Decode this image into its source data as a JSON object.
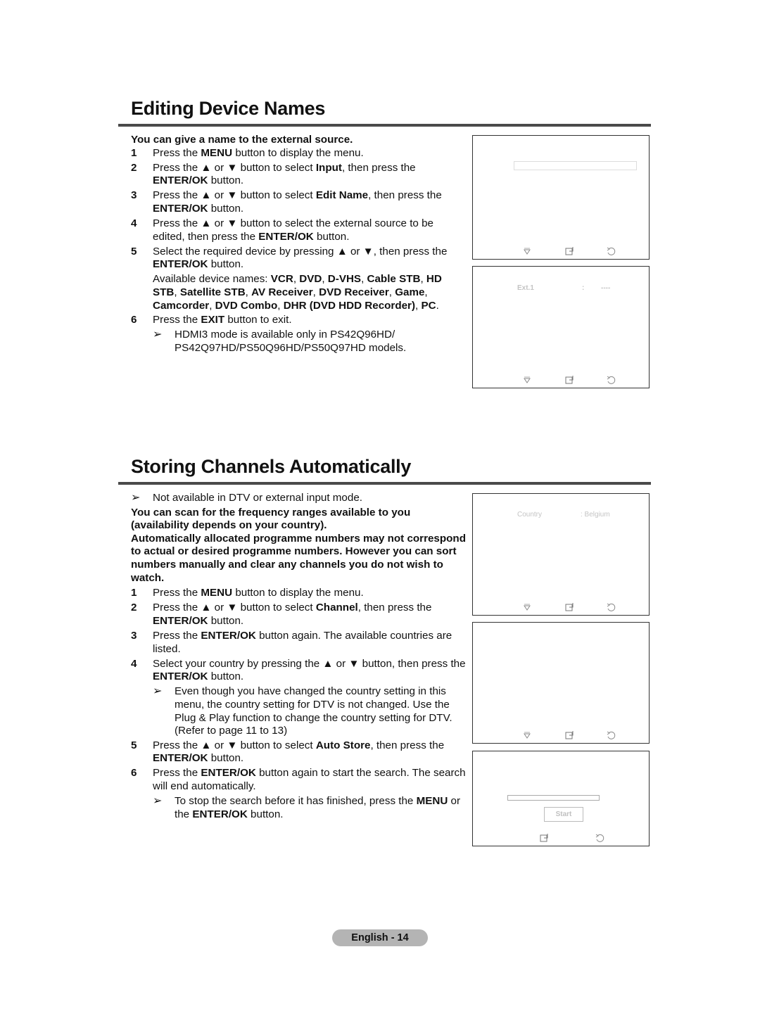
{
  "section1": {
    "title": "Editing Device Names",
    "lead": "You can give a name to the external source.",
    "steps": [
      {
        "num": "1",
        "parts": [
          [
            "Press the ",
            false
          ],
          [
            "MENU",
            true
          ],
          [
            " button to display the menu.",
            false
          ]
        ]
      },
      {
        "num": "2",
        "parts": [
          [
            "Press the ▲ or ▼ button to select ",
            false
          ],
          [
            "Input",
            true
          ],
          [
            ", then press the ",
            false
          ],
          [
            "ENTER/OK",
            true
          ],
          [
            " button.",
            false
          ]
        ]
      },
      {
        "num": "3",
        "parts": [
          [
            "Press the ▲ or ▼ button to select ",
            false
          ],
          [
            "Edit Name",
            true
          ],
          [
            ", then press the ",
            false
          ],
          [
            "ENTER/OK",
            true
          ],
          [
            " button.",
            false
          ]
        ]
      },
      {
        "num": "4",
        "parts": [
          [
            "Press the ▲ or ▼ button to select the external source to be edited, then press the ",
            false
          ],
          [
            "ENTER/OK",
            true
          ],
          [
            " button.",
            false
          ]
        ]
      },
      {
        "num": "5",
        "parts": [
          [
            "Select the required device by pressing ▲ or ▼, then press the ",
            false
          ],
          [
            "ENTER/OK",
            true
          ],
          [
            " button.",
            false
          ]
        ]
      }
    ],
    "available_label": "Available device names: ",
    "device_names": [
      "VCR",
      "DVD",
      "D-VHS",
      "Cable STB",
      "HD STB",
      "Satellite STB",
      "AV Receiver",
      "DVD Receiver",
      "Game",
      "Camcorder",
      "DVD Combo",
      "DHR (DVD HDD Recorder)",
      "PC"
    ],
    "step6": {
      "num": "6",
      "parts": [
        [
          "Press the ",
          false
        ],
        [
          "EXIT",
          true
        ],
        [
          " button to exit.",
          false
        ]
      ]
    },
    "note": "HDMI3 mode is available only in PS42Q96HD/ PS42Q97HD/PS50Q96HD/PS50Q97HD models.",
    "screens": [
      {
        "rows": []
      },
      {
        "source_label": "Ext.1",
        "separator": ":",
        "value": "----"
      }
    ]
  },
  "section2": {
    "title": "Storing Channels Automatically",
    "top_note": "Not available in DTV or external input mode.",
    "lead1": "You can scan for the frequency ranges available to you (availability depends on your country).",
    "lead2": "Automatically allocated programme numbers may not correspond to actual or desired programme numbers. However you can sort numbers manually and clear any channels you do not wish to watch.",
    "steps": [
      {
        "num": "1",
        "parts": [
          [
            "Press the ",
            false
          ],
          [
            "MENU",
            true
          ],
          [
            " button to display the menu.",
            false
          ]
        ]
      },
      {
        "num": "2",
        "parts": [
          [
            "Press the ▲ or ▼ button to select ",
            false
          ],
          [
            "Channel",
            true
          ],
          [
            ", then press the ",
            false
          ],
          [
            "ENTER/OK",
            true
          ],
          [
            " button.",
            false
          ]
        ]
      },
      {
        "num": "3",
        "parts": [
          [
            "Press the ",
            false
          ],
          [
            "ENTER/OK",
            true
          ],
          [
            " button again. The available countries are listed.",
            false
          ]
        ]
      },
      {
        "num": "4",
        "parts": [
          [
            "Select your country by pressing the ▲ or ▼ button, then press the ",
            false
          ],
          [
            "ENTER/OK",
            true
          ],
          [
            " button.",
            false
          ]
        ]
      }
    ],
    "step4_note": "Even though you have changed the country setting in this menu, the country setting for DTV is not changed. Use the Plug & Play function to change the country setting for DTV. (Refer to page 11 to 13)",
    "steps_b": [
      {
        "num": "5",
        "parts": [
          [
            "Press the ▲ or ▼ button to select ",
            false
          ],
          [
            "Auto Store",
            true
          ],
          [
            ", then press the ",
            false
          ],
          [
            "ENTER/OK",
            true
          ],
          [
            " button.",
            false
          ]
        ]
      },
      {
        "num": "6",
        "parts": [
          [
            "Press the ",
            false
          ],
          [
            "ENTER/OK",
            true
          ],
          [
            " button again to start the search. The search will end automatically.",
            false
          ]
        ]
      }
    ],
    "step6_note_parts": [
      [
        "To stop the search before it has finished, press the ",
        false
      ],
      [
        "MENU",
        true
      ],
      [
        " or the ",
        false
      ],
      [
        "ENTER/OK",
        true
      ],
      [
        " button.",
        false
      ]
    ],
    "screens": {
      "country_label": "Country",
      "country_value": ": Belgium",
      "start_button": "Start",
      "progress": 0
    }
  },
  "icons": {
    "move": "move-down-icon",
    "enter": "enter-icon",
    "return": "return-icon"
  },
  "footer": {
    "page_label": "English - 14"
  }
}
